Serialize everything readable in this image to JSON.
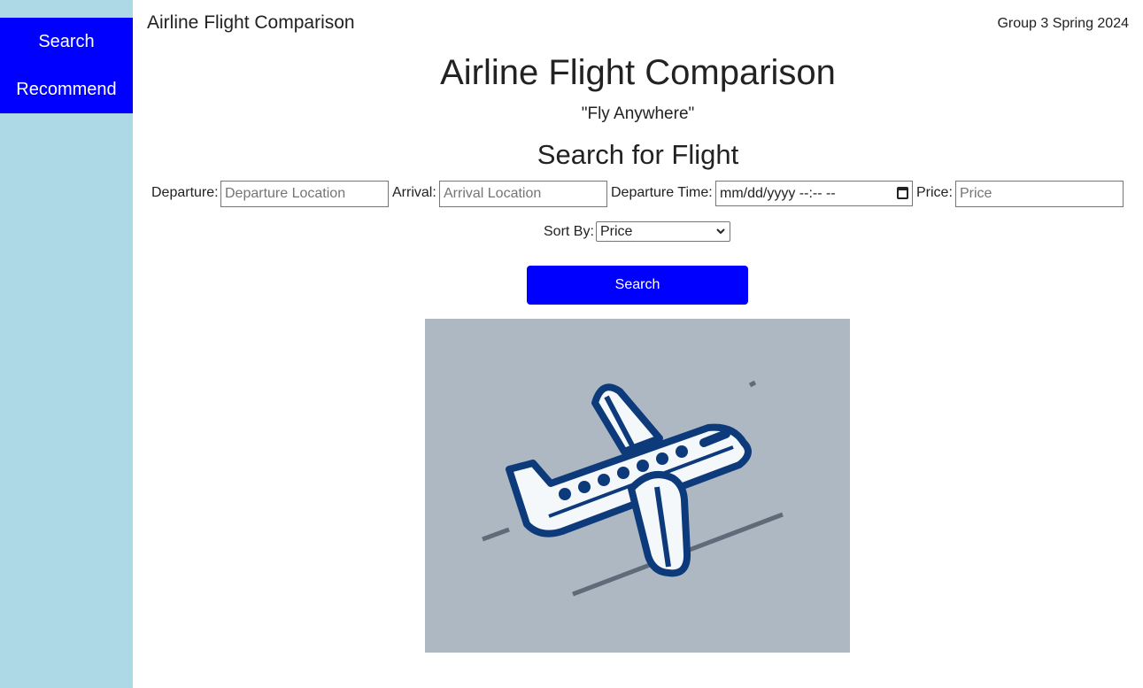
{
  "sidebar": {
    "items": [
      {
        "label": "Search"
      },
      {
        "label": "Recommend"
      }
    ]
  },
  "header": {
    "app_title": "Airline Flight Comparison",
    "group_label": "Group 3 Spring 2024"
  },
  "hero": {
    "title": "Airline Flight Comparison",
    "tagline": "\"Fly Anywhere\""
  },
  "search_form": {
    "section_title": "Search for Flight",
    "departure": {
      "label": "Departure:",
      "placeholder": "Departure Location",
      "value": ""
    },
    "arrival": {
      "label": "Arrival:",
      "placeholder": "Arrival Location",
      "value": ""
    },
    "departure_time": {
      "label": "Departure Time:",
      "value": "mm/dd/yyyy --:-- --",
      "icon": "calendar-icon"
    },
    "price": {
      "label": "Price:",
      "placeholder": "Price",
      "value": ""
    },
    "sort_by": {
      "label": "Sort By:",
      "selected": "Price"
    },
    "submit_label": "Search"
  },
  "illustration": {
    "icon": "airplane-icon",
    "background": "#adb8c2",
    "outline_color": "#0d3a7a",
    "fill_color": "#f4f8fb"
  },
  "colors": {
    "accent": "#0000ff",
    "sidebar_bg": "#add8e6"
  }
}
